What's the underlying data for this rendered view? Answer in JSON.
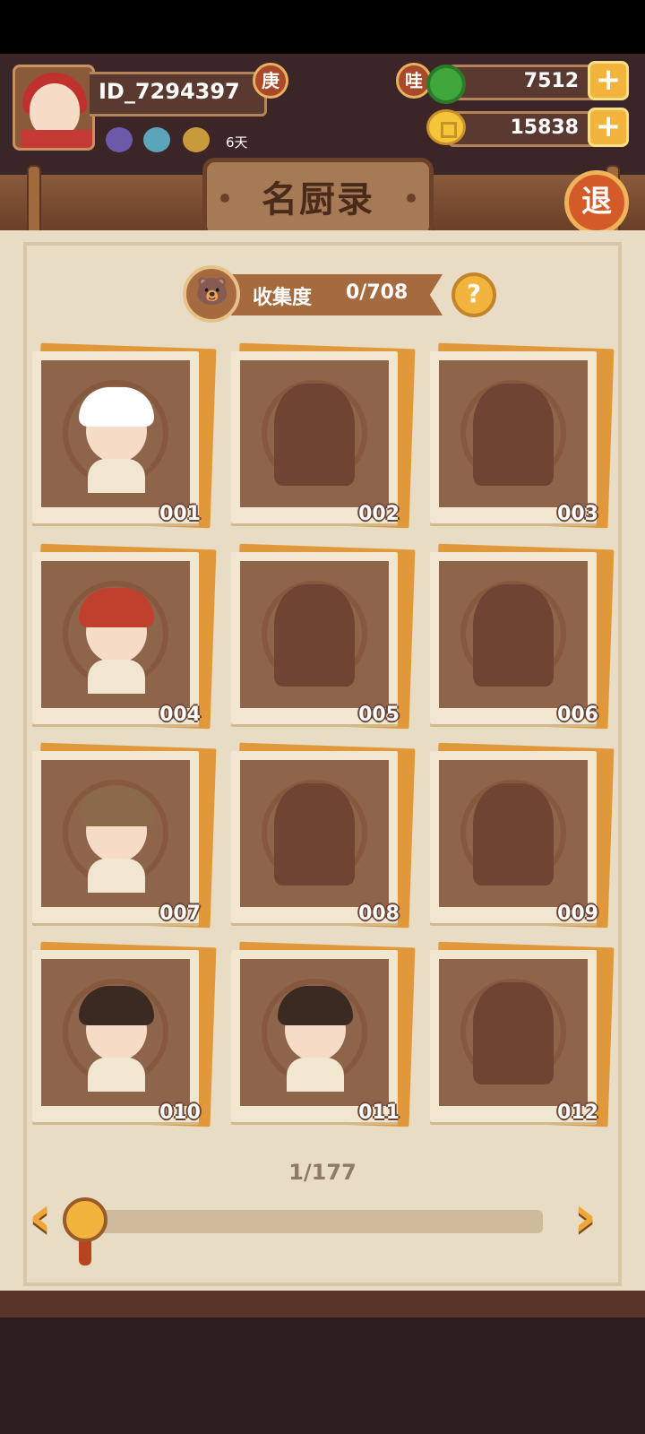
{
  "player": {
    "id": "ID_7294397",
    "rank_badge": "庚",
    "buff_days": "6天"
  },
  "resources": {
    "jade": {
      "badge": "哇",
      "value": "7512",
      "add_label": "+"
    },
    "coins": {
      "value": "15838",
      "add_label": "+"
    }
  },
  "title": "名厨录",
  "exit_label": "退",
  "collection": {
    "label": "收集度",
    "value": "0/708",
    "help_label": "?"
  },
  "cards": [
    {
      "num": "001",
      "unlocked": true
    },
    {
      "num": "002",
      "unlocked": false
    },
    {
      "num": "003",
      "unlocked": false
    },
    {
      "num": "004",
      "unlocked": true
    },
    {
      "num": "005",
      "unlocked": false
    },
    {
      "num": "006",
      "unlocked": false
    },
    {
      "num": "007",
      "unlocked": true
    },
    {
      "num": "008",
      "unlocked": false
    },
    {
      "num": "009",
      "unlocked": false
    },
    {
      "num": "010",
      "unlocked": true
    },
    {
      "num": "011",
      "unlocked": true
    },
    {
      "num": "012",
      "unlocked": false
    }
  ],
  "pager": {
    "current": "1/177",
    "prev": "‹",
    "next": "›",
    "progress": 0.0
  },
  "colors": {
    "accent": "#f2b43c",
    "wood": "#8e644a",
    "paper": "#e9dcc4"
  }
}
